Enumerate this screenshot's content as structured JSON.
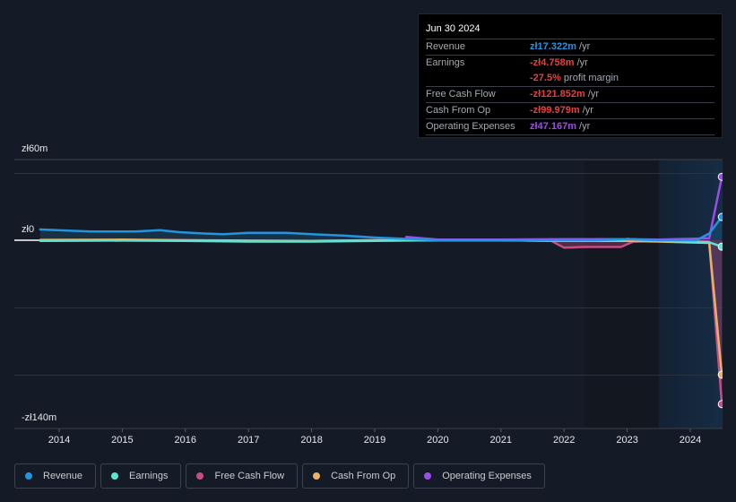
{
  "chart_data": {
    "type": "line",
    "title": "",
    "xlabel": "",
    "ylabel": "",
    "xlim": [
      2013.7,
      2024.5
    ],
    "ylim": [
      -140,
      60
    ],
    "y_ticks": [
      {
        "value": 60,
        "label": "zł60m"
      },
      {
        "value": 0,
        "label": "zł0"
      },
      {
        "value": -140,
        "label": "-zł140m"
      }
    ],
    "gridlines": [
      60,
      50,
      0,
      -50,
      -100
    ],
    "x_ticks": [
      "2014",
      "2015",
      "2016",
      "2017",
      "2018",
      "2019",
      "2020",
      "2021",
      "2022",
      "2023",
      "2024"
    ],
    "forecast_shade_start": 2023.5,
    "legend_position": "bottom",
    "series": [
      {
        "name": "Revenue",
        "color": "#2394df",
        "points": [
          [
            2013.7,
            8
          ],
          [
            2014.5,
            6.5
          ],
          [
            2015.2,
            6.5
          ],
          [
            2015.6,
            7.5
          ],
          [
            2015.9,
            6
          ],
          [
            2016.3,
            5
          ],
          [
            2016.6,
            4.5
          ],
          [
            2017.0,
            5.5
          ],
          [
            2017.6,
            5.5
          ],
          [
            2018.0,
            4.5
          ],
          [
            2018.5,
            3.5
          ],
          [
            2019.0,
            2
          ],
          [
            2019.5,
            1
          ],
          [
            2020.0,
            0
          ],
          [
            2021.0,
            0
          ],
          [
            2022.0,
            0
          ],
          [
            2022.5,
            0
          ],
          [
            2023.0,
            0.8
          ],
          [
            2023.5,
            0
          ],
          [
            2024.1,
            0
          ],
          [
            2024.3,
            5
          ],
          [
            2024.5,
            17.322
          ]
        ]
      },
      {
        "name": "Earnings",
        "color": "#5fe3d1",
        "points": [
          [
            2013.7,
            -0.5
          ],
          [
            2015.0,
            -0.3
          ],
          [
            2016.0,
            -0.5
          ],
          [
            2017.0,
            -1
          ],
          [
            2018.0,
            -1
          ],
          [
            2019.0,
            -0.5
          ],
          [
            2020.0,
            0
          ],
          [
            2021.0,
            0
          ],
          [
            2022.0,
            -0.5
          ],
          [
            2022.9,
            -0.5
          ],
          [
            2023.0,
            1
          ],
          [
            2023.5,
            -0.5
          ],
          [
            2024.3,
            -1.5
          ],
          [
            2024.5,
            -4.758
          ]
        ]
      },
      {
        "name": "Free Cash Flow",
        "color": "#c64d87",
        "points": [
          [
            2013.7,
            0
          ],
          [
            2015.0,
            0.3
          ],
          [
            2016.0,
            0
          ],
          [
            2017.0,
            -0.5
          ],
          [
            2018.0,
            -0.5
          ],
          [
            2019.0,
            0
          ],
          [
            2020.0,
            0
          ],
          [
            2021.0,
            0
          ],
          [
            2021.8,
            -0.5
          ],
          [
            2022.0,
            -5.5
          ],
          [
            2022.3,
            -5
          ],
          [
            2022.9,
            -5
          ],
          [
            2023.1,
            -1
          ],
          [
            2023.5,
            -0.5
          ],
          [
            2024.3,
            -1
          ],
          [
            2024.5,
            -121.852
          ]
        ]
      },
      {
        "name": "Cash From Op",
        "color": "#e7b166",
        "points": [
          [
            2013.7,
            0.3
          ],
          [
            2015.0,
            0.5
          ],
          [
            2016.0,
            0
          ],
          [
            2017.0,
            -0.3
          ],
          [
            2018.0,
            -0.5
          ],
          [
            2019.0,
            0
          ],
          [
            2020.0,
            0
          ],
          [
            2021.0,
            0
          ],
          [
            2022.0,
            -0.5
          ],
          [
            2023.0,
            -0.5
          ],
          [
            2023.5,
            -1
          ],
          [
            2024.3,
            -2
          ],
          [
            2024.5,
            -99.979
          ]
        ]
      },
      {
        "name": "Operating Expenses",
        "color": "#9b4de8",
        "points": [
          [
            2019.5,
            2.5
          ],
          [
            2020.0,
            0.5
          ],
          [
            2021.0,
            0.5
          ],
          [
            2022.0,
            0.8
          ],
          [
            2023.0,
            0.8
          ],
          [
            2023.5,
            0.5
          ],
          [
            2024.3,
            1.5
          ],
          [
            2024.5,
            47.167
          ]
        ]
      }
    ]
  },
  "tooltip": {
    "date": "Jun 30 2024",
    "rows": [
      {
        "label": "Revenue",
        "value": "zł17.322m",
        "unit": " /yr",
        "color": "#2394df"
      },
      {
        "label": "Earnings",
        "value": "-zł4.758m",
        "unit": " /yr",
        "color": "#e8403d"
      },
      {
        "label": "",
        "value": "-27.5%",
        "unit": " profit margin",
        "color": "#e8403d"
      },
      {
        "label": "Free Cash Flow",
        "value": "-zł121.852m",
        "unit": " /yr",
        "color": "#e8403d"
      },
      {
        "label": "Cash From Op",
        "value": "-zł99.979m",
        "unit": " /yr",
        "color": "#e8403d"
      },
      {
        "label": "Operating Expenses",
        "value": "zł47.167m",
        "unit": " /yr",
        "color": "#9b4de8"
      }
    ]
  },
  "legend": [
    {
      "label": "Revenue",
      "color": "#2394df"
    },
    {
      "label": "Earnings",
      "color": "#5fe3d1"
    },
    {
      "label": "Free Cash Flow",
      "color": "#c64d87"
    },
    {
      "label": "Cash From Op",
      "color": "#e7b166"
    },
    {
      "label": "Operating Expenses",
      "color": "#9b4de8"
    }
  ]
}
